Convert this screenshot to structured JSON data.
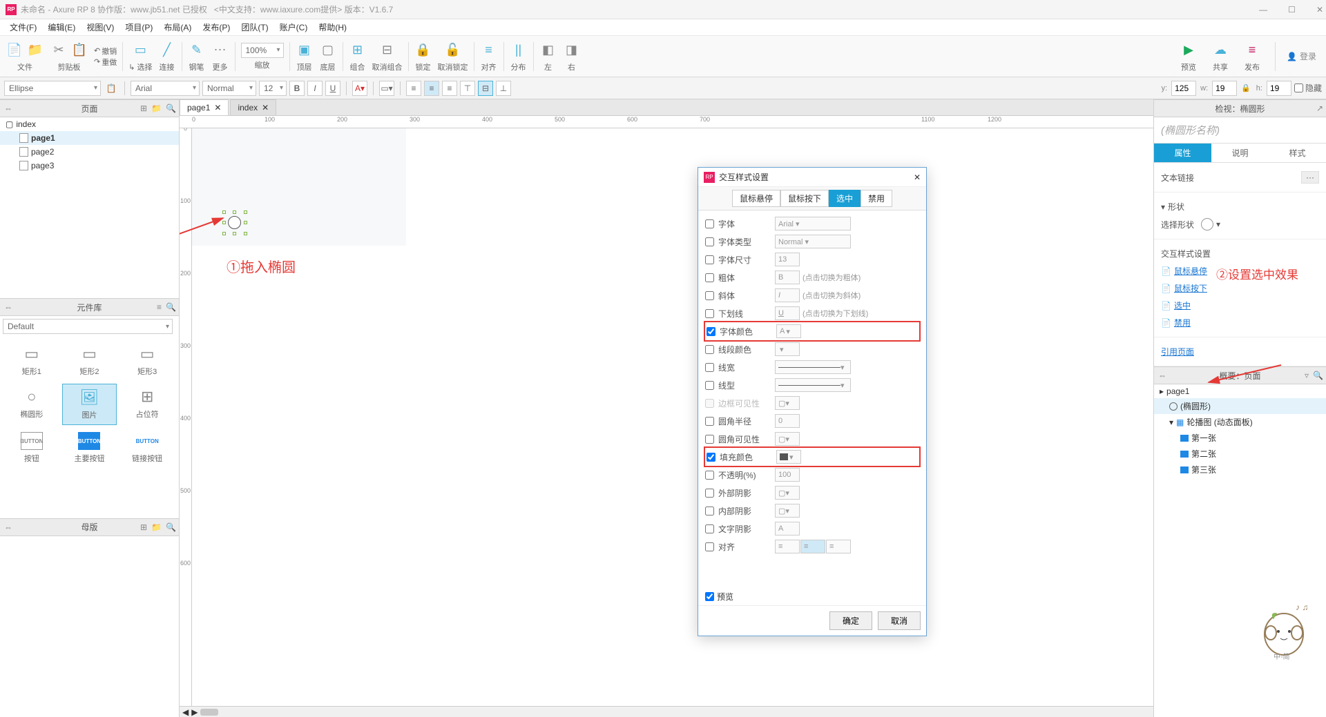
{
  "title": {
    "app": "未命名 - Axure RP 8 协作版：www.jb51.net 已授权",
    "support": "<中文支持：www.iaxure.com提供> 版本：V1.6.7"
  },
  "menubar": [
    "文件(F)",
    "编辑(E)",
    "视图(V)",
    "项目(P)",
    "布局(A)",
    "发布(P)",
    "团队(T)",
    "账户(C)",
    "帮助(H)"
  ],
  "toolbar": {
    "file": "文件",
    "clipboard": "剪贴板",
    "undo": "撤销",
    "redo": "重做",
    "select": "选择",
    "connect": "连接",
    "pen": "钢笔",
    "more": "更多",
    "zoom_value": "100%",
    "zoom": "缩放",
    "front": "顶层",
    "back": "底层",
    "group": "组合",
    "ungroup": "取消组合",
    "lock": "锁定",
    "unlock": "取消锁定",
    "align": "对齐",
    "distribute": "分布",
    "left": "左",
    "right": "右",
    "preview": "预览",
    "share": "共享",
    "publish": "发布",
    "login": "登录"
  },
  "formatbar": {
    "shape": "Ellipse",
    "font": "Arial",
    "weight": "Normal",
    "size": "12",
    "pos_y_lbl": "y:",
    "pos_y": "125",
    "pos_w_lbl": "w:",
    "pos_w": "19",
    "pos_h_lbl": "h:",
    "pos_h": "19",
    "hidden": "隐藏",
    "lock_icon": "🔒"
  },
  "pages": {
    "title": "页面",
    "root": "index",
    "items": [
      "page1",
      "page2",
      "page3"
    ]
  },
  "library": {
    "title": "元件库",
    "default": "Default",
    "items": [
      {
        "label": "矩形1"
      },
      {
        "label": "矩形2"
      },
      {
        "label": "矩形3"
      },
      {
        "label": "椭圆形"
      },
      {
        "label": "图片"
      },
      {
        "label": "占位符"
      },
      {
        "label": "按钮"
      },
      {
        "label": "主要按钮"
      },
      {
        "label": "链接按钮"
      }
    ]
  },
  "masters": {
    "title": "母版"
  },
  "tabs": [
    "page1",
    "index"
  ],
  "ruler_h": [
    "0",
    "100",
    "200",
    "300",
    "400",
    "500",
    "600",
    "700",
    "1100",
    "1200"
  ],
  "ruler_v": [
    "0",
    "100",
    "200",
    "300",
    "400",
    "500",
    "600"
  ],
  "anno1": "①拖入椭圆",
  "anno2": "②设置选中效果",
  "inspector": {
    "header": "检视：椭圆形",
    "placeholder": "(椭圆形名称)",
    "tabs": [
      "属性",
      "说明",
      "样式"
    ],
    "textlink": "文本链接",
    "shape": "形状",
    "choose": "选择形状",
    "ix_title": "交互样式设置",
    "ix_hover": "鼠标悬停",
    "ix_down": "鼠标按下",
    "ix_selected": "选中",
    "ix_disabled": "禁用",
    "refpage": "引用页面"
  },
  "outline": {
    "title": "概要：页面",
    "items": [
      {
        "label": "page1",
        "cls": ""
      },
      {
        "label": "(椭圆形)",
        "cls": "ind1 sel",
        "icon": "ellipse"
      },
      {
        "label": "轮播图 (动态面板)",
        "cls": "ind1",
        "icon": "panel"
      },
      {
        "label": "第一张",
        "cls": "ind2",
        "icon": "state"
      },
      {
        "label": "第二张",
        "cls": "ind2",
        "icon": "state"
      },
      {
        "label": "第三张",
        "cls": "ind2",
        "icon": "state"
      }
    ]
  },
  "dialog": {
    "title": "交互样式设置",
    "close": "✕",
    "tabs": [
      "鼠标悬停",
      "鼠标按下",
      "选中",
      "禁用"
    ],
    "rows": [
      {
        "label": "字体",
        "ctrl": "Arial",
        "type": "select"
      },
      {
        "label": "字体类型",
        "ctrl": "Normal",
        "type": "select"
      },
      {
        "label": "字体尺寸",
        "ctrl": "13",
        "type": "num"
      },
      {
        "label": "粗体",
        "hint": "(点击切换为粗体)",
        "type": "toggle",
        "glyph": "B"
      },
      {
        "label": "斜体",
        "hint": "(点击切换为斜体)",
        "type": "toggle",
        "glyph": "I"
      },
      {
        "label": "下划线",
        "hint": "(点击切换为下划线)",
        "type": "toggle",
        "glyph": "U"
      },
      {
        "label": "字体颜色",
        "type": "color",
        "checked": true,
        "hl": true,
        "glyph": "A"
      },
      {
        "label": "线段颜色",
        "type": "color"
      },
      {
        "label": "线宽",
        "type": "line"
      },
      {
        "label": "线型",
        "type": "line"
      },
      {
        "label": "边框可见性",
        "type": "box",
        "disabled": true
      },
      {
        "label": "圆角半径",
        "ctrl": "0",
        "type": "num"
      },
      {
        "label": "圆角可见性",
        "type": "box"
      },
      {
        "label": "填充颜色",
        "type": "color",
        "checked": true,
        "hl": true,
        "fill": "#555"
      },
      {
        "label": "不透明(%)",
        "ctrl": "100",
        "type": "num"
      },
      {
        "label": "外部阴影",
        "type": "box"
      },
      {
        "label": "内部阴影",
        "type": "box"
      },
      {
        "label": "文字阴影",
        "type": "toggle",
        "glyph": "A"
      },
      {
        "label": "对齐",
        "type": "align"
      }
    ],
    "preview": "预览",
    "ok": "确定",
    "cancel": "取消"
  }
}
